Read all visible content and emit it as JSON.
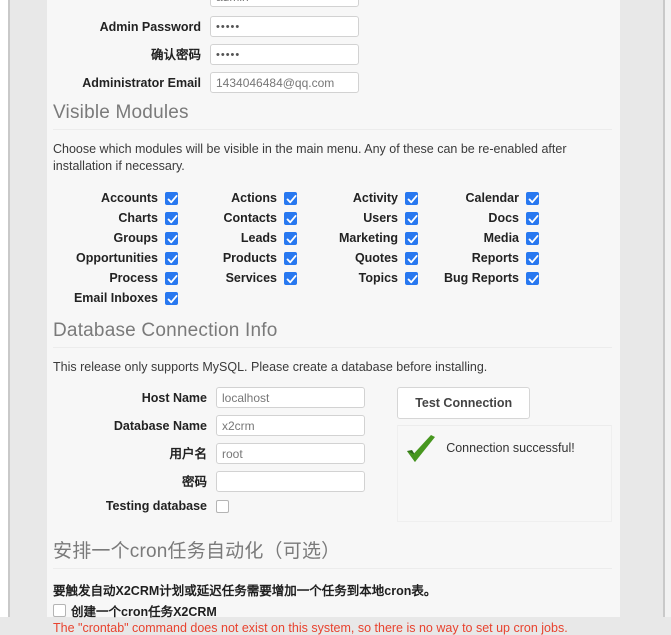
{
  "admin_fields": [
    {
      "label": "",
      "value": "admin",
      "type": "text",
      "name": "admin-username",
      "clipped": true
    },
    {
      "label": "Admin Password",
      "value": "•••••",
      "type": "password",
      "name": "admin-password"
    },
    {
      "label": "确认密码",
      "value": "•••••",
      "type": "password",
      "name": "confirm-password"
    },
    {
      "label": "Administrator Email",
      "value": "1434046484@qq.com",
      "type": "text",
      "name": "administrator-email"
    }
  ],
  "modules_section": {
    "heading": "Visible Modules",
    "blurb": "Choose which modules will be visible in the main menu. Any of these can be re-enabled after installation if necessary.",
    "columns": [
      [
        {
          "label": "Accounts",
          "checked": true
        },
        {
          "label": "Charts",
          "checked": true
        },
        {
          "label": "Groups",
          "checked": true
        },
        {
          "label": "Opportunities",
          "checked": true
        },
        {
          "label": "Process",
          "checked": true
        },
        {
          "label": "Email Inboxes",
          "checked": true
        }
      ],
      [
        {
          "label": "Actions",
          "checked": true
        },
        {
          "label": "Contacts",
          "checked": true
        },
        {
          "label": "Leads",
          "checked": true
        },
        {
          "label": "Products",
          "checked": true
        },
        {
          "label": "Services",
          "checked": true
        }
      ],
      [
        {
          "label": "Activity",
          "checked": true
        },
        {
          "label": "Users",
          "checked": true
        },
        {
          "label": "Marketing",
          "checked": true
        },
        {
          "label": "Quotes",
          "checked": true
        },
        {
          "label": "Topics",
          "checked": true
        }
      ],
      [
        {
          "label": "Calendar",
          "checked": true
        },
        {
          "label": "Docs",
          "checked": true
        },
        {
          "label": "Media",
          "checked": true
        },
        {
          "label": "Reports",
          "checked": true
        },
        {
          "label": "Bug Reports",
          "checked": true
        }
      ]
    ]
  },
  "database_section": {
    "heading": "Database Connection Info",
    "blurb": "This release only supports MySQL. Please create a database before installing.",
    "fields": [
      {
        "label": "Host Name",
        "value": "localhost",
        "name": "host-name"
      },
      {
        "label": "Database Name",
        "value": "x2crm",
        "name": "database-name"
      },
      {
        "label": "用户名",
        "value": "root",
        "name": "db-username"
      },
      {
        "label": "密码",
        "value": "",
        "name": "db-password"
      }
    ],
    "testing_database_label": "Testing database",
    "testing_database_checked": false,
    "test_button_label": "Test Connection",
    "result_text": "Connection successful!",
    "result_icon": "green-check-icon",
    "result_color": "#3d8b22"
  },
  "cron_section": {
    "heading": "安排一个cron任务自动化（可选）",
    "note": "要触发自动X2CRM计划或延迟任务需要增加一个任务到本地cron表。",
    "checkbox_label": "创建一个cron任务X2CRM",
    "checkbox_checked": false,
    "error": "The \"crontab\" command does not exist on this system, so there is no way to set up cron jobs.",
    "error_color": "#e8432f"
  },
  "theme": {
    "accent_checkbox": "#2878f0",
    "page_bg": "#f7f7f7",
    "gutter_bg": "#e8e8e8",
    "heading_color": "#7a7a7a"
  }
}
